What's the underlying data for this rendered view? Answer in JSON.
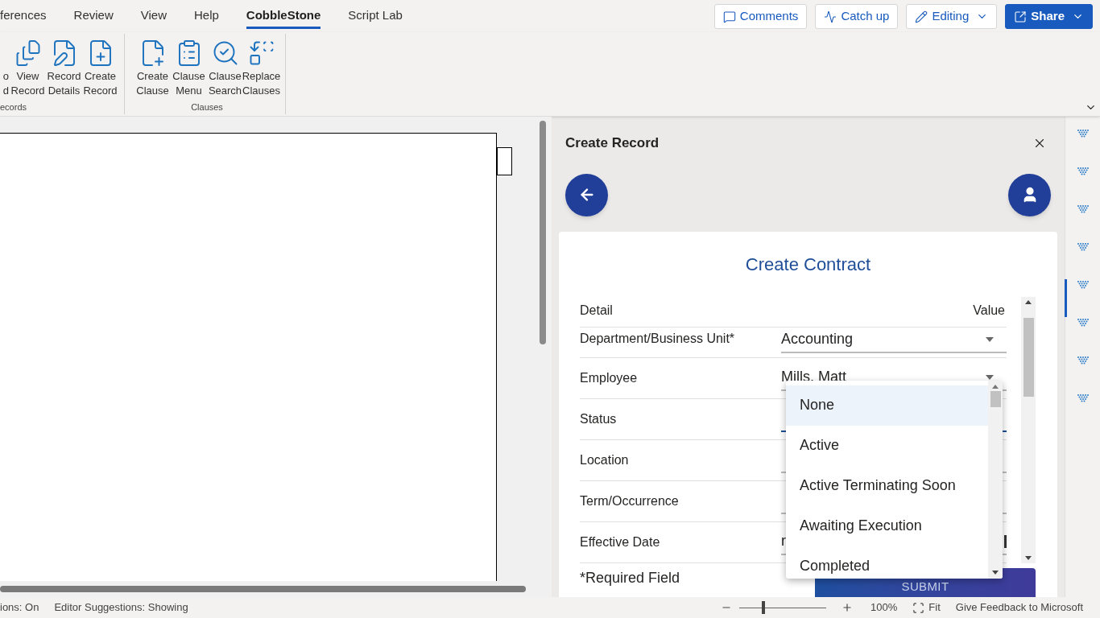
{
  "ribbon_tabs": [
    {
      "label": "ferences",
      "selected": false
    },
    {
      "label": "Review",
      "selected": false
    },
    {
      "label": "View",
      "selected": false
    },
    {
      "label": "Help",
      "selected": false
    },
    {
      "label": "CobbleStone",
      "selected": true
    },
    {
      "label": "Script Lab",
      "selected": false
    }
  ],
  "header_buttons": [
    {
      "label": "Comments",
      "kind": "comment"
    },
    {
      "label": "Catch up",
      "kind": "activity"
    },
    {
      "label": "Editing",
      "kind": "edit"
    },
    {
      "label": "Share",
      "kind": "share"
    }
  ],
  "ribbon_groups": [
    {
      "label": "ecords",
      "buttons": [
        {
          "lines": [
            "o",
            "d"
          ],
          "kind": "cut"
        },
        {
          "lines": [
            "View",
            "Record"
          ],
          "kind": "view"
        },
        {
          "lines": [
            "Record",
            "Details"
          ],
          "kind": "details"
        },
        {
          "lines": [
            "Create",
            "Record"
          ],
          "kind": "create"
        }
      ]
    },
    {
      "label": "Clauses",
      "buttons": [
        {
          "lines": [
            "Create",
            "Clause"
          ],
          "kind": "clause-add"
        },
        {
          "lines": [
            "Clause",
            "Menu"
          ],
          "kind": "menu"
        },
        {
          "lines": [
            "Clause",
            "Search"
          ],
          "kind": "search"
        },
        {
          "lines": [
            "Replace",
            "Clauses"
          ],
          "kind": "replace"
        }
      ]
    }
  ],
  "task_pane": {
    "title": "Create Record",
    "form": {
      "title": "Create Contract",
      "columns": [
        "Detail",
        "Value"
      ],
      "rows": [
        {
          "label": "Department/Business Unit*",
          "value": "Accounting",
          "kind": "select",
          "focused": false
        },
        {
          "label": "Employee",
          "value": "Mills, Matt",
          "kind": "select",
          "focused": false
        },
        {
          "label": "Status",
          "kind": "text",
          "focused": true
        },
        {
          "label": "Location",
          "kind": "text",
          "focused": false
        },
        {
          "label": "Term/Occurrence",
          "kind": "text",
          "focused": false
        },
        {
          "label": "Effective Date",
          "value": "r",
          "kind": "date",
          "focused": false
        }
      ],
      "note": "*Required Field",
      "submit": "SUBMIT"
    },
    "dropdown": {
      "options": [
        {
          "label": "None",
          "selected": true
        },
        {
          "label": "Active",
          "selected": false
        },
        {
          "label": "Active Terminating Soon",
          "selected": false
        },
        {
          "label": "Awaiting Execution",
          "selected": false
        },
        {
          "label": "Completed",
          "selected": false
        }
      ]
    }
  },
  "rail_items": [
    {
      "selected": false
    },
    {
      "selected": false
    },
    {
      "selected": false
    },
    {
      "selected": false
    },
    {
      "selected": true
    },
    {
      "selected": false
    },
    {
      "selected": false
    },
    {
      "selected": false
    }
  ],
  "status_bar": {
    "left": [
      "ions: On",
      "Editor Suggestions: Showing"
    ],
    "zoom": {
      "level": 0.26,
      "reading": "100%"
    },
    "fit": "Fit",
    "feedback": "Give Feedback to Microsoft"
  }
}
